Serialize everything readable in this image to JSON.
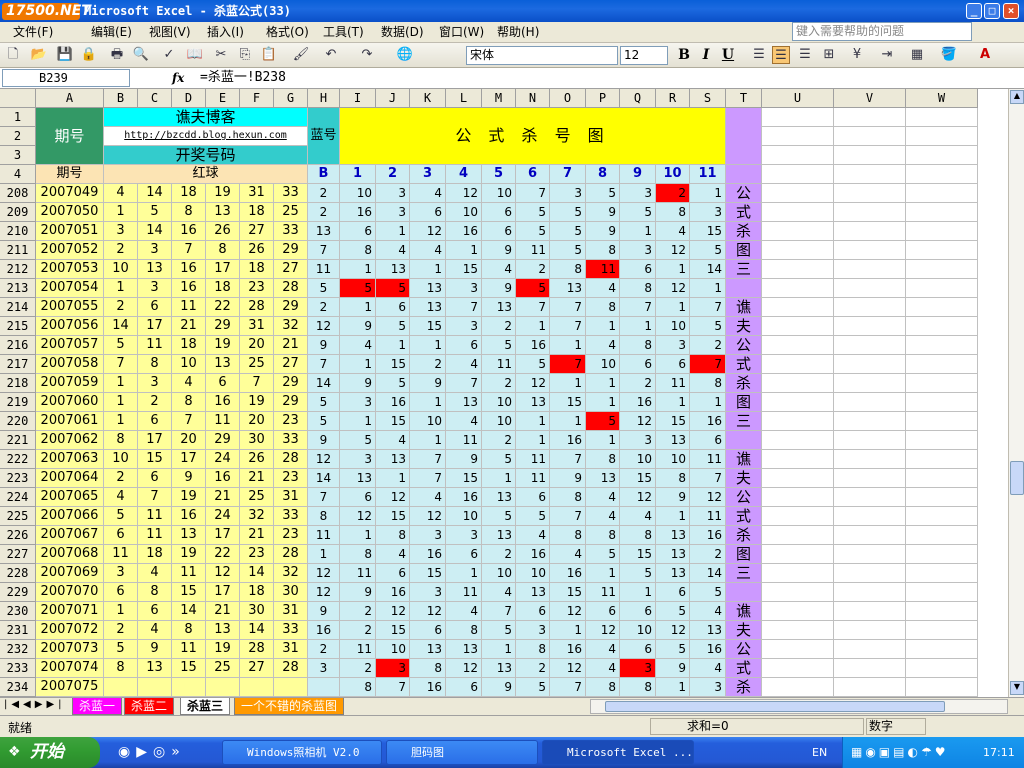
{
  "window": {
    "title": "Microsoft Excel - 杀蓝公式(33)",
    "logo": "17500.NET"
  },
  "menu": [
    "文件(F)",
    "编辑(E)",
    "视图(V)",
    "插入(I)",
    "格式(O)",
    "工具(T)",
    "数据(D)",
    "窗口(W)",
    "帮助(H)"
  ],
  "help_placeholder": "键入需要帮助的问题",
  "toolbar": {
    "font": "宋体",
    "size": "12",
    "bold": "B",
    "italic": "I",
    "underline": "U"
  },
  "formula": {
    "cell": "B239",
    "fx": "fx",
    "content": "=杀蓝一!B238"
  },
  "columns": [
    "A",
    "B",
    "C",
    "D",
    "E",
    "F",
    "G",
    "H",
    "I",
    "J",
    "K",
    "L",
    "M",
    "N",
    "O",
    "P",
    "Q",
    "R",
    "S",
    "T",
    "U",
    "V",
    "W"
  ],
  "header": {
    "qihao": "期号",
    "blog": "谯夫博客",
    "url": "http://bzcdd.blog.hexun.com",
    "kaijiang": "开奖号码",
    "lanhao": "蓝号",
    "title": "公 式 杀 号 图",
    "row4_qihao": "期号",
    "row4_red": "红球",
    "row4_b": "B",
    "formula_nums": [
      "1",
      "2",
      "3",
      "4",
      "5",
      "6",
      "7",
      "8",
      "9",
      "10",
      "11"
    ]
  },
  "header_rows": [
    "1",
    "2",
    "3",
    "4"
  ],
  "side_text": [
    "公",
    "式",
    "杀",
    "图",
    "三",
    "",
    "谯",
    "夫",
    "公",
    "式",
    "杀",
    "图",
    "三",
    "",
    "谯",
    "夫",
    "公",
    "式",
    "杀",
    "图",
    "三",
    "",
    "谯",
    "夫",
    "公",
    "式",
    "杀"
  ],
  "rows": [
    {
      "n": "208",
      "q": "2007049",
      "red": [
        "4",
        "14",
        "18",
        "19",
        "31",
        "33"
      ],
      "b": "2",
      "f": [
        "10",
        "3",
        "4",
        "12",
        "10",
        "7",
        "3",
        "5",
        "3",
        "2",
        "1"
      ],
      "hl": [
        9
      ]
    },
    {
      "n": "209",
      "q": "2007050",
      "red": [
        "1",
        "5",
        "8",
        "13",
        "18",
        "25"
      ],
      "b": "2",
      "f": [
        "16",
        "3",
        "6",
        "10",
        "6",
        "5",
        "5",
        "9",
        "5",
        "8",
        "3"
      ],
      "hl": []
    },
    {
      "n": "210",
      "q": "2007051",
      "red": [
        "3",
        "14",
        "16",
        "26",
        "27",
        "33"
      ],
      "b": "13",
      "f": [
        "6",
        "1",
        "12",
        "16",
        "6",
        "5",
        "5",
        "9",
        "1",
        "4",
        "15"
      ],
      "hl": []
    },
    {
      "n": "211",
      "q": "2007052",
      "red": [
        "2",
        "3",
        "7",
        "8",
        "26",
        "29"
      ],
      "b": "7",
      "f": [
        "8",
        "4",
        "4",
        "1",
        "9",
        "11",
        "5",
        "8",
        "3",
        "12",
        "5"
      ],
      "hl": []
    },
    {
      "n": "212",
      "q": "2007053",
      "red": [
        "10",
        "13",
        "16",
        "17",
        "18",
        "27"
      ],
      "b": "11",
      "f": [
        "1",
        "13",
        "1",
        "15",
        "4",
        "2",
        "8",
        "11",
        "6",
        "1",
        "14"
      ],
      "hl": [
        7
      ]
    },
    {
      "n": "213",
      "q": "2007054",
      "red": [
        "1",
        "3",
        "16",
        "18",
        "23",
        "28"
      ],
      "b": "5",
      "f": [
        "5",
        "5",
        "13",
        "3",
        "9",
        "5",
        "13",
        "4",
        "8",
        "12",
        "1"
      ],
      "hl": [
        0,
        1,
        5
      ]
    },
    {
      "n": "214",
      "q": "2007055",
      "red": [
        "2",
        "6",
        "11",
        "22",
        "28",
        "29"
      ],
      "b": "2",
      "f": [
        "1",
        "6",
        "13",
        "7",
        "13",
        "7",
        "7",
        "8",
        "7",
        "1",
        "7"
      ],
      "hl": []
    },
    {
      "n": "215",
      "q": "2007056",
      "red": [
        "14",
        "17",
        "21",
        "29",
        "31",
        "32"
      ],
      "b": "12",
      "f": [
        "9",
        "5",
        "15",
        "3",
        "2",
        "1",
        "7",
        "1",
        "1",
        "10",
        "5"
      ],
      "hl": []
    },
    {
      "n": "216",
      "q": "2007057",
      "red": [
        "5",
        "11",
        "18",
        "19",
        "20",
        "21"
      ],
      "b": "9",
      "f": [
        "4",
        "1",
        "1",
        "6",
        "5",
        "16",
        "1",
        "4",
        "8",
        "3",
        "2"
      ],
      "hl": []
    },
    {
      "n": "217",
      "q": "2007058",
      "red": [
        "7",
        "8",
        "10",
        "13",
        "25",
        "27"
      ],
      "b": "7",
      "f": [
        "1",
        "15",
        "2",
        "4",
        "11",
        "5",
        "7",
        "10",
        "6",
        "6",
        "7"
      ],
      "hl": [
        6,
        10
      ]
    },
    {
      "n": "218",
      "q": "2007059",
      "red": [
        "1",
        "3",
        "4",
        "6",
        "7",
        "29"
      ],
      "b": "14",
      "f": [
        "9",
        "5",
        "9",
        "7",
        "2",
        "12",
        "1",
        "1",
        "2",
        "11",
        "8"
      ],
      "hl": []
    },
    {
      "n": "219",
      "q": "2007060",
      "red": [
        "1",
        "2",
        "8",
        "16",
        "19",
        "29"
      ],
      "b": "5",
      "f": [
        "3",
        "16",
        "1",
        "13",
        "10",
        "13",
        "15",
        "1",
        "16",
        "1",
        "1"
      ],
      "hl": []
    },
    {
      "n": "220",
      "q": "2007061",
      "red": [
        "1",
        "6",
        "7",
        "11",
        "20",
        "23"
      ],
      "b": "5",
      "f": [
        "1",
        "15",
        "10",
        "4",
        "10",
        "1",
        "1",
        "5",
        "12",
        "15",
        "16"
      ],
      "hl": [
        7
      ]
    },
    {
      "n": "221",
      "q": "2007062",
      "red": [
        "8",
        "17",
        "20",
        "29",
        "30",
        "33"
      ],
      "b": "9",
      "f": [
        "5",
        "4",
        "1",
        "11",
        "2",
        "1",
        "16",
        "1",
        "3",
        "13",
        "6"
      ],
      "hl": []
    },
    {
      "n": "222",
      "q": "2007063",
      "red": [
        "10",
        "15",
        "17",
        "24",
        "26",
        "28"
      ],
      "b": "12",
      "f": [
        "3",
        "13",
        "7",
        "9",
        "5",
        "11",
        "7",
        "8",
        "10",
        "10",
        "11"
      ],
      "hl": []
    },
    {
      "n": "223",
      "q": "2007064",
      "red": [
        "2",
        "6",
        "9",
        "16",
        "21",
        "23"
      ],
      "b": "14",
      "f": [
        "13",
        "1",
        "7",
        "15",
        "1",
        "11",
        "9",
        "13",
        "15",
        "8",
        "7"
      ],
      "hl": []
    },
    {
      "n": "224",
      "q": "2007065",
      "red": [
        "4",
        "7",
        "19",
        "21",
        "25",
        "31"
      ],
      "b": "7",
      "f": [
        "6",
        "12",
        "4",
        "16",
        "13",
        "6",
        "8",
        "4",
        "12",
        "9",
        "12"
      ],
      "hl": []
    },
    {
      "n": "225",
      "q": "2007066",
      "red": [
        "5",
        "11",
        "16",
        "24",
        "32",
        "33"
      ],
      "b": "8",
      "f": [
        "12",
        "15",
        "12",
        "10",
        "5",
        "5",
        "7",
        "4",
        "4",
        "1",
        "11"
      ],
      "hl": []
    },
    {
      "n": "226",
      "q": "2007067",
      "red": [
        "6",
        "11",
        "13",
        "17",
        "21",
        "23"
      ],
      "b": "11",
      "f": [
        "1",
        "8",
        "3",
        "3",
        "13",
        "4",
        "8",
        "8",
        "8",
        "13",
        "16"
      ],
      "hl": []
    },
    {
      "n": "227",
      "q": "2007068",
      "red": [
        "11",
        "18",
        "19",
        "22",
        "23",
        "28"
      ],
      "b": "1",
      "f": [
        "8",
        "4",
        "16",
        "6",
        "2",
        "16",
        "4",
        "5",
        "15",
        "13",
        "2"
      ],
      "hl": []
    },
    {
      "n": "228",
      "q": "2007069",
      "red": [
        "3",
        "4",
        "11",
        "12",
        "14",
        "32"
      ],
      "b": "12",
      "f": [
        "11",
        "6",
        "15",
        "1",
        "10",
        "10",
        "16",
        "1",
        "5",
        "13",
        "14"
      ],
      "hl": []
    },
    {
      "n": "229",
      "q": "2007070",
      "red": [
        "6",
        "8",
        "15",
        "17",
        "18",
        "30"
      ],
      "b": "12",
      "f": [
        "9",
        "16",
        "3",
        "11",
        "4",
        "13",
        "15",
        "11",
        "1",
        "6",
        "5"
      ],
      "hl": []
    },
    {
      "n": "230",
      "q": "2007071",
      "red": [
        "1",
        "6",
        "14",
        "21",
        "30",
        "31"
      ],
      "b": "9",
      "f": [
        "2",
        "12",
        "12",
        "4",
        "7",
        "6",
        "12",
        "6",
        "6",
        "5",
        "4"
      ],
      "hl": []
    },
    {
      "n": "231",
      "q": "2007072",
      "red": [
        "2",
        "4",
        "8",
        "13",
        "14",
        "33"
      ],
      "b": "16",
      "f": [
        "2",
        "15",
        "6",
        "8",
        "5",
        "3",
        "1",
        "12",
        "10",
        "12",
        "13"
      ],
      "hl": []
    },
    {
      "n": "232",
      "q": "2007073",
      "red": [
        "5",
        "9",
        "11",
        "19",
        "28",
        "31"
      ],
      "b": "2",
      "f": [
        "11",
        "10",
        "13",
        "13",
        "1",
        "8",
        "16",
        "4",
        "6",
        "5",
        "16"
      ],
      "hl": []
    },
    {
      "n": "233",
      "q": "2007074",
      "red": [
        "8",
        "13",
        "15",
        "25",
        "27",
        "28"
      ],
      "b": "3",
      "f": [
        "2",
        "3",
        "8",
        "12",
        "13",
        "2",
        "12",
        "4",
        "3",
        "9",
        "4"
      ],
      "hl": [
        1,
        8
      ]
    },
    {
      "n": "234",
      "q": "2007075",
      "red": [
        "",
        "",
        "",
        "",
        "",
        ""
      ],
      "b": "",
      "f": [
        "8",
        "7",
        "16",
        "6",
        "9",
        "5",
        "7",
        "8",
        "8",
        "1",
        "3"
      ],
      "hl": []
    }
  ],
  "sheet_tabs": [
    {
      "label": "杀蓝一",
      "color": "#ff00ff"
    },
    {
      "label": "杀蓝二",
      "color": "#ff0000"
    },
    {
      "label": "杀蓝三",
      "color": "#ffffff"
    },
    {
      "label": "一个不错的杀蓝图",
      "color": "#ff9900"
    }
  ],
  "status": {
    "ready": "就绪",
    "sum": "求和=0",
    "mode": "数字"
  },
  "taskbar": {
    "start": "开始",
    "tasks": [
      "Windows照相机 V2.0",
      "胆码图",
      "Microsoft Excel ..."
    ],
    "lang": "EN",
    "clock": "17:11"
  }
}
